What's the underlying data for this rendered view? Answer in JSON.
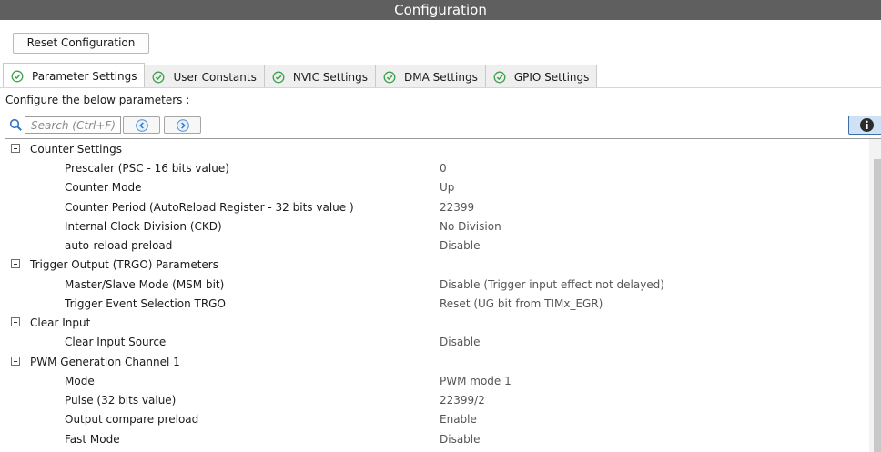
{
  "window": {
    "title": "Configuration"
  },
  "toolbar": {
    "reset_label": "Reset Configuration"
  },
  "tabs": [
    {
      "label": "Parameter Settings",
      "icon": "check-circle-icon",
      "active": true
    },
    {
      "label": "User Constants",
      "icon": "check-circle-icon",
      "active": false
    },
    {
      "label": "NVIC Settings",
      "icon": "check-circle-icon",
      "active": false
    },
    {
      "label": "DMA Settings",
      "icon": "check-circle-icon",
      "active": false
    },
    {
      "label": "GPIO Settings",
      "icon": "check-circle-icon",
      "active": false
    }
  ],
  "intro": "Configure the below parameters :",
  "search": {
    "placeholder": "Search (Ctrl+F)",
    "value": ""
  },
  "colors": {
    "titlebar": "#5f5f5f",
    "check": "#3aa34a",
    "info": "#3d6ea8"
  },
  "groups": [
    {
      "label": "Counter Settings",
      "params": [
        {
          "name": "Prescaler (PSC - 16 bits value)",
          "value": "0"
        },
        {
          "name": "Counter Mode",
          "value": "Up"
        },
        {
          "name": "Counter Period (AutoReload Register - 32 bits value )",
          "value": "22399"
        },
        {
          "name": "Internal Clock Division (CKD)",
          "value": "No Division"
        },
        {
          "name": "auto-reload preload",
          "value": "Disable"
        }
      ]
    },
    {
      "label": "Trigger Output (TRGO) Parameters",
      "params": [
        {
          "name": "Master/Slave Mode (MSM bit)",
          "value": "Disable (Trigger input effect not delayed)"
        },
        {
          "name": "Trigger Event Selection TRGO",
          "value": "Reset (UG bit from TIMx_EGR)"
        }
      ]
    },
    {
      "label": "Clear Input",
      "params": [
        {
          "name": "Clear Input Source",
          "value": "Disable"
        }
      ]
    },
    {
      "label": "PWM Generation Channel 1",
      "params": [
        {
          "name": "Mode",
          "value": "PWM mode 1"
        },
        {
          "name": "Pulse (32 bits value)",
          "value": "22399/2"
        },
        {
          "name": "Output compare preload",
          "value": "Enable"
        },
        {
          "name": "Fast Mode",
          "value": "Disable"
        }
      ]
    }
  ]
}
